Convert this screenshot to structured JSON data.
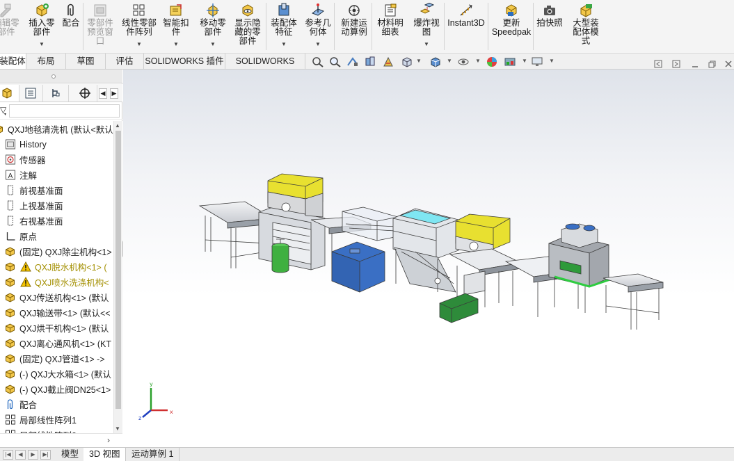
{
  "ribbon": {
    "buttons": [
      {
        "name": "edit-component-button",
        "label": "编辑零\n部件",
        "icon": "edit-component-icon",
        "disabled": true
      },
      {
        "name": "insert-component-button",
        "label": "插入零\n部件",
        "icon": "insert-component-icon",
        "disabled": false
      },
      {
        "name": "mate-button",
        "label": "配合",
        "icon": "paperclip-icon",
        "disabled": false
      },
      {
        "name": "component-preview-button",
        "label": "零部件\n预览窗\n口",
        "icon": "preview-window-icon",
        "disabled": true
      },
      {
        "name": "linear-pattern-button",
        "label": "线性零部\n件阵列",
        "icon": "linear-pattern-icon",
        "disabled": false
      },
      {
        "name": "smart-fasteners-button",
        "label": "智能扣\n件",
        "icon": "smart-fastener-icon",
        "disabled": false
      },
      {
        "name": "move-component-button",
        "label": "移动零\n部件",
        "icon": "move-component-icon",
        "disabled": false
      },
      {
        "name": "show-hidden-button",
        "label": "显示隐\n藏的零\n部件",
        "icon": "show-hidden-icon",
        "disabled": false
      },
      {
        "name": "assembly-features-button",
        "label": "装配体\n特征",
        "icon": "assembly-feature-icon",
        "disabled": false
      },
      {
        "name": "reference-geometry-button",
        "label": "参考几\n何体",
        "icon": "reference-geometry-icon",
        "disabled": false
      },
      {
        "name": "new-motion-study-button",
        "label": "新建运\n动算例",
        "icon": "motion-study-icon",
        "disabled": false
      },
      {
        "name": "bom-button",
        "label": "材料明\n细表",
        "icon": "bom-icon",
        "disabled": false
      },
      {
        "name": "exploded-view-button",
        "label": "爆炸视\n图",
        "icon": "exploded-view-icon",
        "disabled": false
      },
      {
        "name": "instant3d-button",
        "label": "Instant3D",
        "icon": "instant3d-icon",
        "disabled": false
      },
      {
        "name": "update-speedpak-button",
        "label": "更新\nSpeedpak",
        "icon": "speedpak-icon",
        "disabled": false
      },
      {
        "name": "snapshot-button",
        "label": "拍快照",
        "icon": "camera-icon",
        "disabled": false
      },
      {
        "name": "large-assembly-button",
        "label": "大型装\n配体模\n式",
        "icon": "large-assembly-icon",
        "disabled": false
      }
    ]
  },
  "tabs": [
    "装配体",
    "布局",
    "草图",
    "评估",
    "SOLIDWORKS 插件",
    "SOLIDWORKS MBD"
  ],
  "tree": {
    "root": "QXJ地毯清洗机  (默认<默认",
    "items": [
      {
        "label": "History",
        "icon": "history-icon",
        "warn": false
      },
      {
        "label": "传感器",
        "icon": "sensor-icon",
        "warn": false
      },
      {
        "label": "注解",
        "icon": "annotation-icon",
        "warn": false
      },
      {
        "label": "前视基准面",
        "icon": "plane-icon",
        "warn": false
      },
      {
        "label": "上视基准面",
        "icon": "plane-icon",
        "warn": false
      },
      {
        "label": "右视基准面",
        "icon": "plane-icon",
        "warn": false
      },
      {
        "label": "原点",
        "icon": "origin-icon",
        "warn": false
      },
      {
        "label": "(固定) QXJ除尘机构<1>",
        "icon": "assembly-icon",
        "warn": false
      },
      {
        "label": "QXJ脱水机构<1> (",
        "icon": "assembly-icon",
        "warn": true
      },
      {
        "label": "QXJ喷水洗涤机构<",
        "icon": "assembly-icon",
        "warn": true
      },
      {
        "label": "QXJ传送机构<1> (默认",
        "icon": "assembly-icon",
        "warn": false
      },
      {
        "label": "QXJ输送带<1> (默认<<",
        "icon": "assembly-icon",
        "warn": false
      },
      {
        "label": "QXJ烘干机构<1> (默认",
        "icon": "assembly-icon",
        "warn": false
      },
      {
        "label": "QXJ离心通风机<1> (KT",
        "icon": "assembly-icon",
        "warn": false
      },
      {
        "label": "(固定) QXJ管道<1> ->",
        "icon": "assembly-icon",
        "warn": false
      },
      {
        "label": "(-) QXJ大水箱<1> (默认",
        "icon": "assembly-icon",
        "warn": false
      },
      {
        "label": "(-) QXJ截止阀DN25<1>",
        "icon": "assembly-icon",
        "warn": false
      },
      {
        "label": "配合",
        "icon": "mates-icon",
        "warn": false
      },
      {
        "label": "局部线性阵列1",
        "icon": "pattern-icon",
        "warn": false
      },
      {
        "label": "局部线性阵列2",
        "icon": "pattern-icon",
        "warn": false
      }
    ]
  },
  "bottom_tabs": [
    "模型",
    "3D 视图",
    "运动算例 1"
  ],
  "triad": {
    "x": "x",
    "y": "y",
    "z": "z"
  },
  "colors": {
    "yellow_hood": "#e8e030",
    "blue_tank": "#3a6fc4",
    "green_base": "#2e8b3a",
    "frame": "#a9aeb6"
  }
}
